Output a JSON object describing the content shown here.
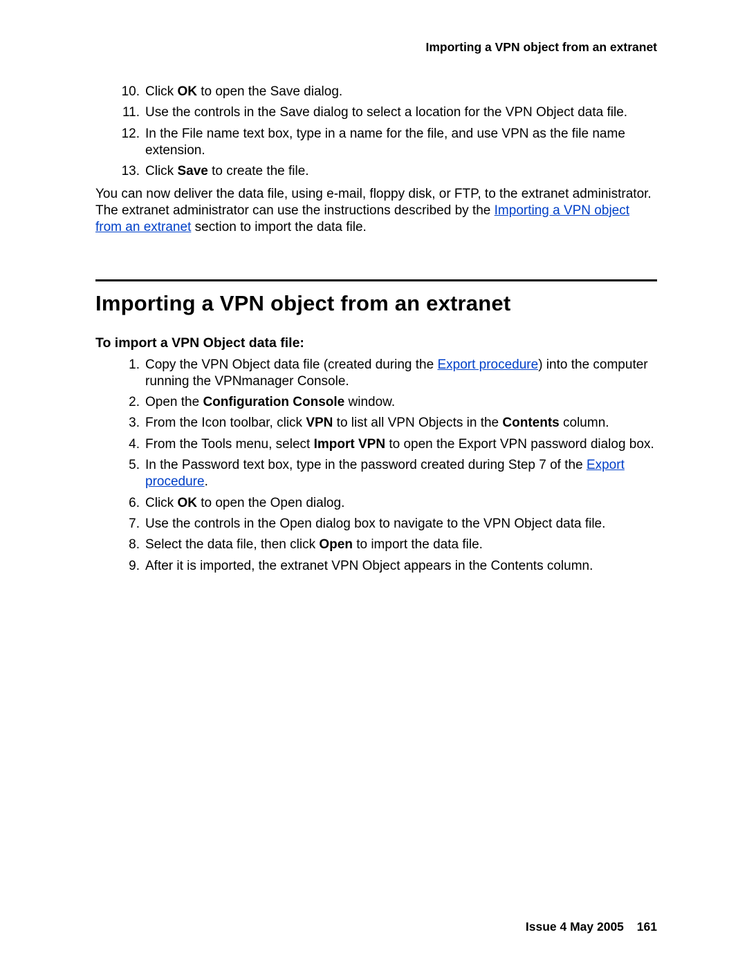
{
  "header": {
    "running_title": "Importing a VPN object from an extranet"
  },
  "top_steps": [
    {
      "n": "10.",
      "pre": "Click ",
      "bold": "OK",
      "post": " to open the Save dialog."
    },
    {
      "n": "11.",
      "plain": "Use the controls in the Save dialog to select a location for the VPN Object data file."
    },
    {
      "n": "12.",
      "plain": "In the File name text box, type in a name for the file, and use VPN as the file name extension."
    },
    {
      "n": "13.",
      "pre": "Click ",
      "bold": "Save",
      "post": " to create the file."
    }
  ],
  "deliver_para": {
    "before": "You can now deliver the data file, using e-mail, floppy disk, or FTP, to the extranet administrator. The extranet administrator can use the instructions described by the ",
    "link": "Importing a VPN object from an extranet",
    "after": " section to import the data file."
  },
  "section": {
    "title": "Importing a VPN object from an extranet",
    "subtitle": "To import a VPN Object data file:"
  },
  "steps": {
    "s1": {
      "n": "1.",
      "before": "Copy the VPN Object data file (created during the ",
      "link": "Export procedure",
      "after": ") into the computer running the VPNmanager Console."
    },
    "s2": {
      "n": "2.",
      "before": "Open the ",
      "bold": "Configuration Console",
      "after": " window."
    },
    "s3": {
      "n": "3.",
      "before": "From the Icon toolbar, click ",
      "bold1": "VPN",
      "mid": " to list all VPN Objects in the ",
      "bold2": "Contents",
      "after": " column."
    },
    "s4": {
      "n": "4.",
      "before": "From the Tools menu, select ",
      "bold": "Import VPN",
      "after": " to open the Export VPN password dialog box."
    },
    "s5": {
      "n": "5.",
      "before": "In the Password text box, type in the password created during Step 7 of the ",
      "link": "Export procedure",
      "after": "."
    },
    "s6": {
      "n": "6.",
      "before": "Click ",
      "bold": "OK",
      "after": " to open the Open dialog."
    },
    "s7": {
      "n": "7.",
      "plain": "Use the controls in the Open dialog box to navigate to the VPN Object data file."
    },
    "s8": {
      "n": "8.",
      "before": "Select the data file, then click ",
      "bold": "Open",
      "after": " to import the data file."
    },
    "s9": {
      "n": "9.",
      "plain": "After it is imported, the extranet VPN Object appears in the Contents column."
    }
  },
  "footer": {
    "issue": "Issue 4   May 2005",
    "page": "161"
  }
}
